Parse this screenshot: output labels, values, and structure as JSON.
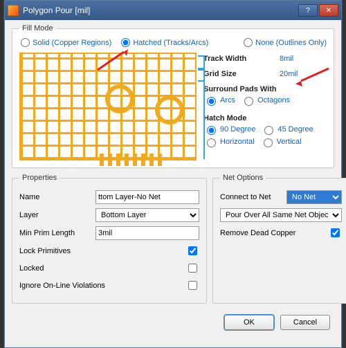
{
  "window": {
    "title": "Polygon Pour [mil]"
  },
  "fillmode": {
    "legend": "Fill Mode",
    "solid": "Solid (Copper Regions)",
    "hatched": "Hatched (Tracks/Arcs)",
    "none": "None (Outlines Only)",
    "selected": "hatched"
  },
  "side": {
    "track_width_label": "Track Width",
    "track_width_value": "8mil",
    "grid_size_label": "Grid Size",
    "grid_size_value": "20mil",
    "surround_label": "Surround Pads With",
    "surround_arcs": "Arcs",
    "surround_oct": "Octagons",
    "hatch_label": "Hatch Mode",
    "hatch_90": "90 Degree",
    "hatch_45": "45 Degree",
    "hatch_horiz": "Horizontal",
    "hatch_vert": "Vertical"
  },
  "properties": {
    "legend": "Properties",
    "name_label": "Name",
    "name_value": "ttom Layer-No Net",
    "layer_label": "Layer",
    "layer_value": "Bottom Layer",
    "min_prim_label": "Min Prim Length",
    "min_prim_value": "3mil",
    "lock_prims": "Lock Primitives",
    "locked": "Locked",
    "ignore_viol": "Ignore On-Line Violations"
  },
  "netopts": {
    "legend": "Net Options",
    "connect_label": "Connect to Net",
    "connect_value": "No Net",
    "pour_rule": "Pour Over All Same Net Objects",
    "remove_dead": "Remove Dead Copper"
  },
  "buttons": {
    "ok": "OK",
    "cancel": "Cancel"
  }
}
